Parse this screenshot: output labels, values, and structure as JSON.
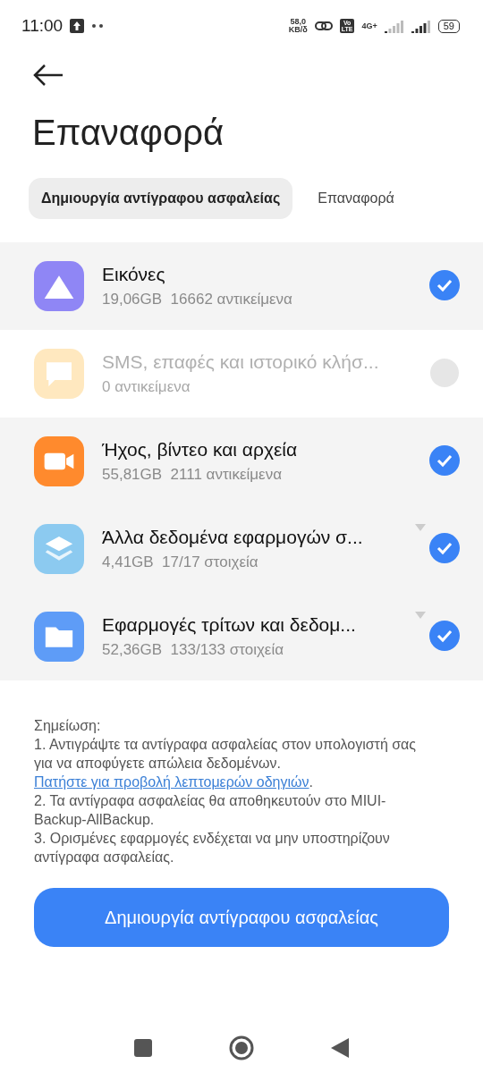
{
  "status_bar": {
    "time": "11:00",
    "speed_value": "58,0",
    "speed_unit": "KB/δ",
    "volte_top": "Vo",
    "volte_bottom": "LTE",
    "network": "4G+",
    "battery": "59"
  },
  "title": "Επαναφορά",
  "tabs": [
    {
      "label": "Δημιουργία αντίγραφου ασφαλείας",
      "selected": true
    },
    {
      "label": "Επαναφορά",
      "selected": false
    }
  ],
  "items": [
    {
      "kind": "pictures",
      "title": "Εικόνες",
      "size": "19,06GB",
      "count": "16662 αντικείμενα",
      "checked": true,
      "disabled": false,
      "expandable": false
    },
    {
      "kind": "messages",
      "title": "SMS, επαφές και ιστορικό κλήσ...",
      "count": "0 αντικείμενα",
      "checked": false,
      "disabled": true,
      "expandable": false
    },
    {
      "kind": "video",
      "title": "Ήχος, βίντεο και αρχεία",
      "size": "55,81GB",
      "count": "2111 αντικείμενα",
      "checked": true,
      "disabled": false,
      "expandable": false
    },
    {
      "kind": "layers",
      "title": "Άλλα δεδομένα εφαρμογών σ...",
      "size": "4,41GB",
      "count": "17/17 στοιχεία",
      "checked": true,
      "disabled": false,
      "expandable": true
    },
    {
      "kind": "folder",
      "title": "Εφαρμογές τρίτων και δεδομ...",
      "size": "52,36GB",
      "count": "133/133 στοιχεία",
      "checked": true,
      "disabled": false,
      "expandable": true
    }
  ],
  "note": {
    "heading": "Σημείωση:",
    "point_1": "1. Αντιγράψτε τα αντίγραφα ασφαλείας στον υπολογιστή σας για να αποφύγετε απώλεια δεδομένων.",
    "link": "Πατήστε για προβολή λεπτομερών οδηγιών",
    "link_after": ".",
    "point_2": "2. Τα αντίγραφα ασφαλείας θα αποθηκευτούν στο MIUI-Backup-AllBackup.",
    "point_3": "3. Ορισμένες εφαρμογές ενδέχεται να μην υποστηρίζουν αντίγραφα ασφαλείας."
  },
  "primary_button": "Δημιουργία αντίγραφου ασφαλείας"
}
